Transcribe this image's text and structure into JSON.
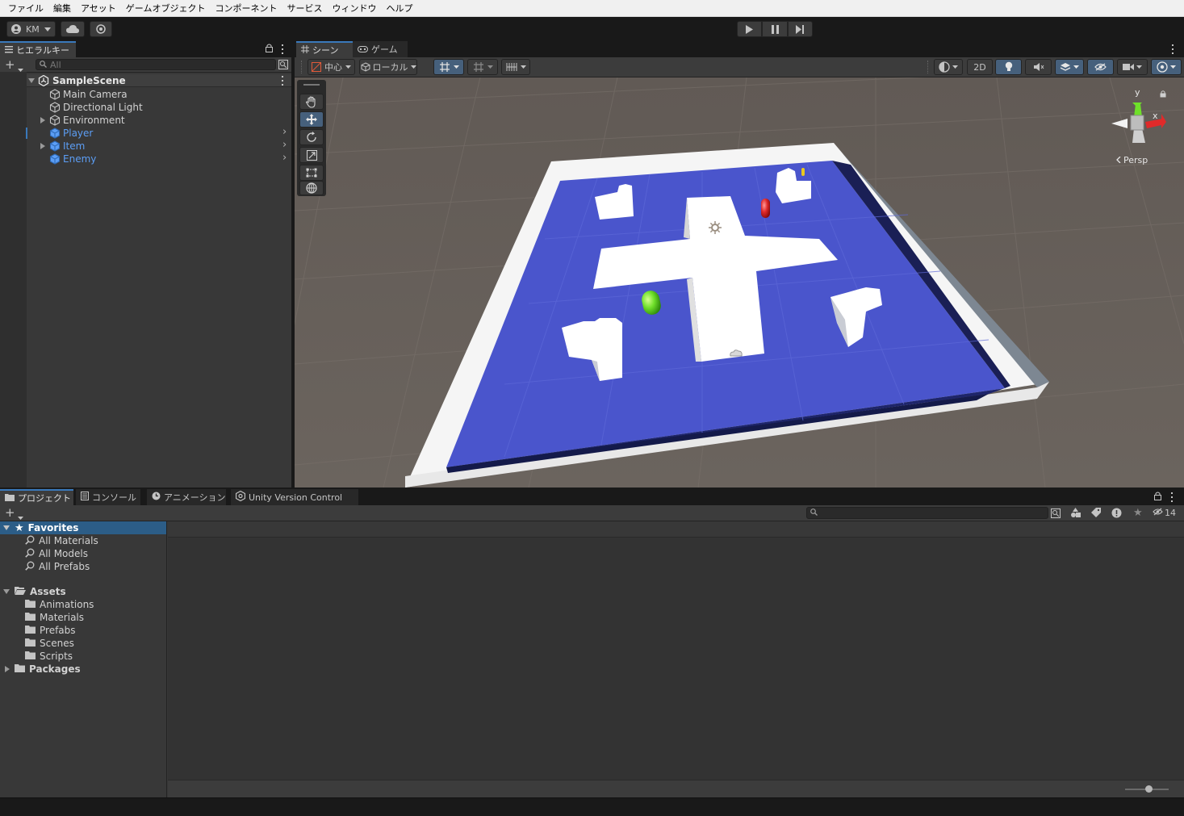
{
  "menu": [
    "ファイル",
    "編集",
    "アセット",
    "ゲームオブジェクト",
    "コンポーネント",
    "サービス",
    "ウィンドウ",
    "ヘルプ"
  ],
  "toolbar": {
    "account_label": "KM",
    "play_controls": [
      "play",
      "pause",
      "step"
    ]
  },
  "hierarchy": {
    "tab_label": "ヒエラルキー",
    "search_placeholder": "All",
    "scene_name": "SampleScene",
    "items": [
      {
        "label": "Main Camera",
        "prefab": false,
        "expandable": false
      },
      {
        "label": "Directional Light",
        "prefab": false,
        "expandable": false
      },
      {
        "label": "Environment",
        "prefab": false,
        "expandable": true
      },
      {
        "label": "Player",
        "prefab": true,
        "expandable": false
      },
      {
        "label": "Item",
        "prefab": true,
        "expandable": true
      },
      {
        "label": "Enemy",
        "prefab": true,
        "expandable": false
      }
    ]
  },
  "scene_view": {
    "tabs": [
      "シーン",
      "ゲーム"
    ],
    "pivot_label": "中心",
    "space_label": "ローカル",
    "mode_2d_label": "2D",
    "projection_label": "Persp",
    "gizmo_axes": {
      "y": "y",
      "x": "x"
    }
  },
  "project": {
    "tabs": [
      "プロジェクト",
      "コンソール",
      "アニメーション",
      "Unity Version Control"
    ],
    "hidden_count": "14",
    "favorites": {
      "label": "Favorites",
      "items": [
        "All Materials",
        "All Models",
        "All Prefabs"
      ]
    },
    "assets": {
      "label": "Assets",
      "items": [
        "Animations",
        "Materials",
        "Prefabs",
        "Scenes",
        "Scripts"
      ]
    },
    "packages_label": "Packages",
    "zoom_fraction": 0.55
  },
  "colors": {
    "accent": "#3a79bb",
    "prefab_blue": "#5c9ef5",
    "floor_blue": "#4a55cc",
    "player_green": "#6fe02a",
    "enemy_red": "#e02a2a",
    "item_yellow": "#e8c820"
  }
}
